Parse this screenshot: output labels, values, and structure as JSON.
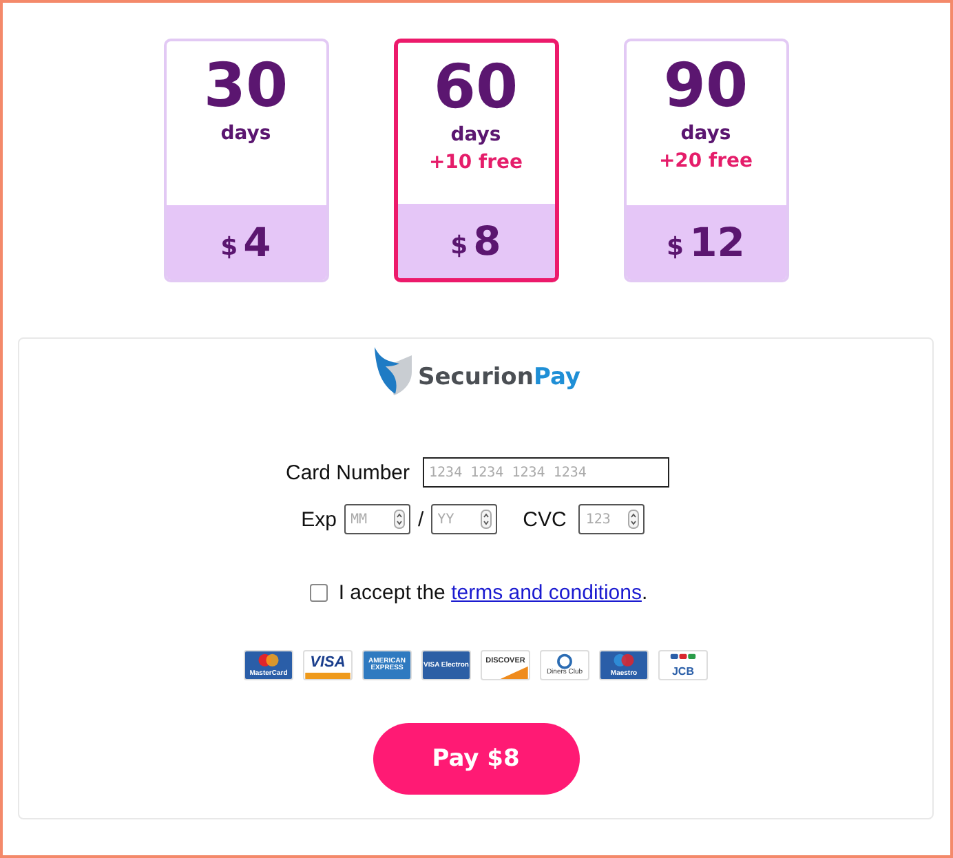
{
  "plans": [
    {
      "days": "30",
      "unit": "days",
      "currency": "$",
      "price": "4",
      "selected": false
    },
    {
      "days": "60",
      "unit": "days",
      "bonus": "+10 free",
      "currency": "$",
      "price": "8",
      "selected": true
    },
    {
      "days": "90",
      "unit": "days",
      "bonus": "+20 free",
      "currency": "$",
      "price": "12",
      "selected": false
    }
  ],
  "payment": {
    "brand": [
      "Securion",
      "Pay"
    ],
    "card_number": {
      "label": "Card Number",
      "placeholder": "1234 1234 1234 1234"
    },
    "exp": {
      "label": "Exp",
      "month_placeholder": "MM",
      "separator": "/",
      "year_placeholder": "YY"
    },
    "cvc": {
      "label": "CVC",
      "placeholder": "123"
    },
    "terms": {
      "checked": false,
      "text": "I accept the ",
      "link": "terms and conditions",
      "end": "."
    },
    "cards": [
      {
        "kind": "mastercard",
        "label": "MasterCard"
      },
      {
        "kind": "visa",
        "label": "VISA"
      },
      {
        "kind": "amex",
        "label": "AMERICAN EXPRESS"
      },
      {
        "kind": "electron",
        "label": "VISA Electron"
      },
      {
        "kind": "discover",
        "label": "DISCOVER"
      },
      {
        "kind": "diners",
        "label": "Diners Club"
      },
      {
        "kind": "maestro",
        "label": "Maestro"
      },
      {
        "kind": "jcb",
        "label": "JCB"
      }
    ],
    "pay_button": "Pay $8"
  }
}
